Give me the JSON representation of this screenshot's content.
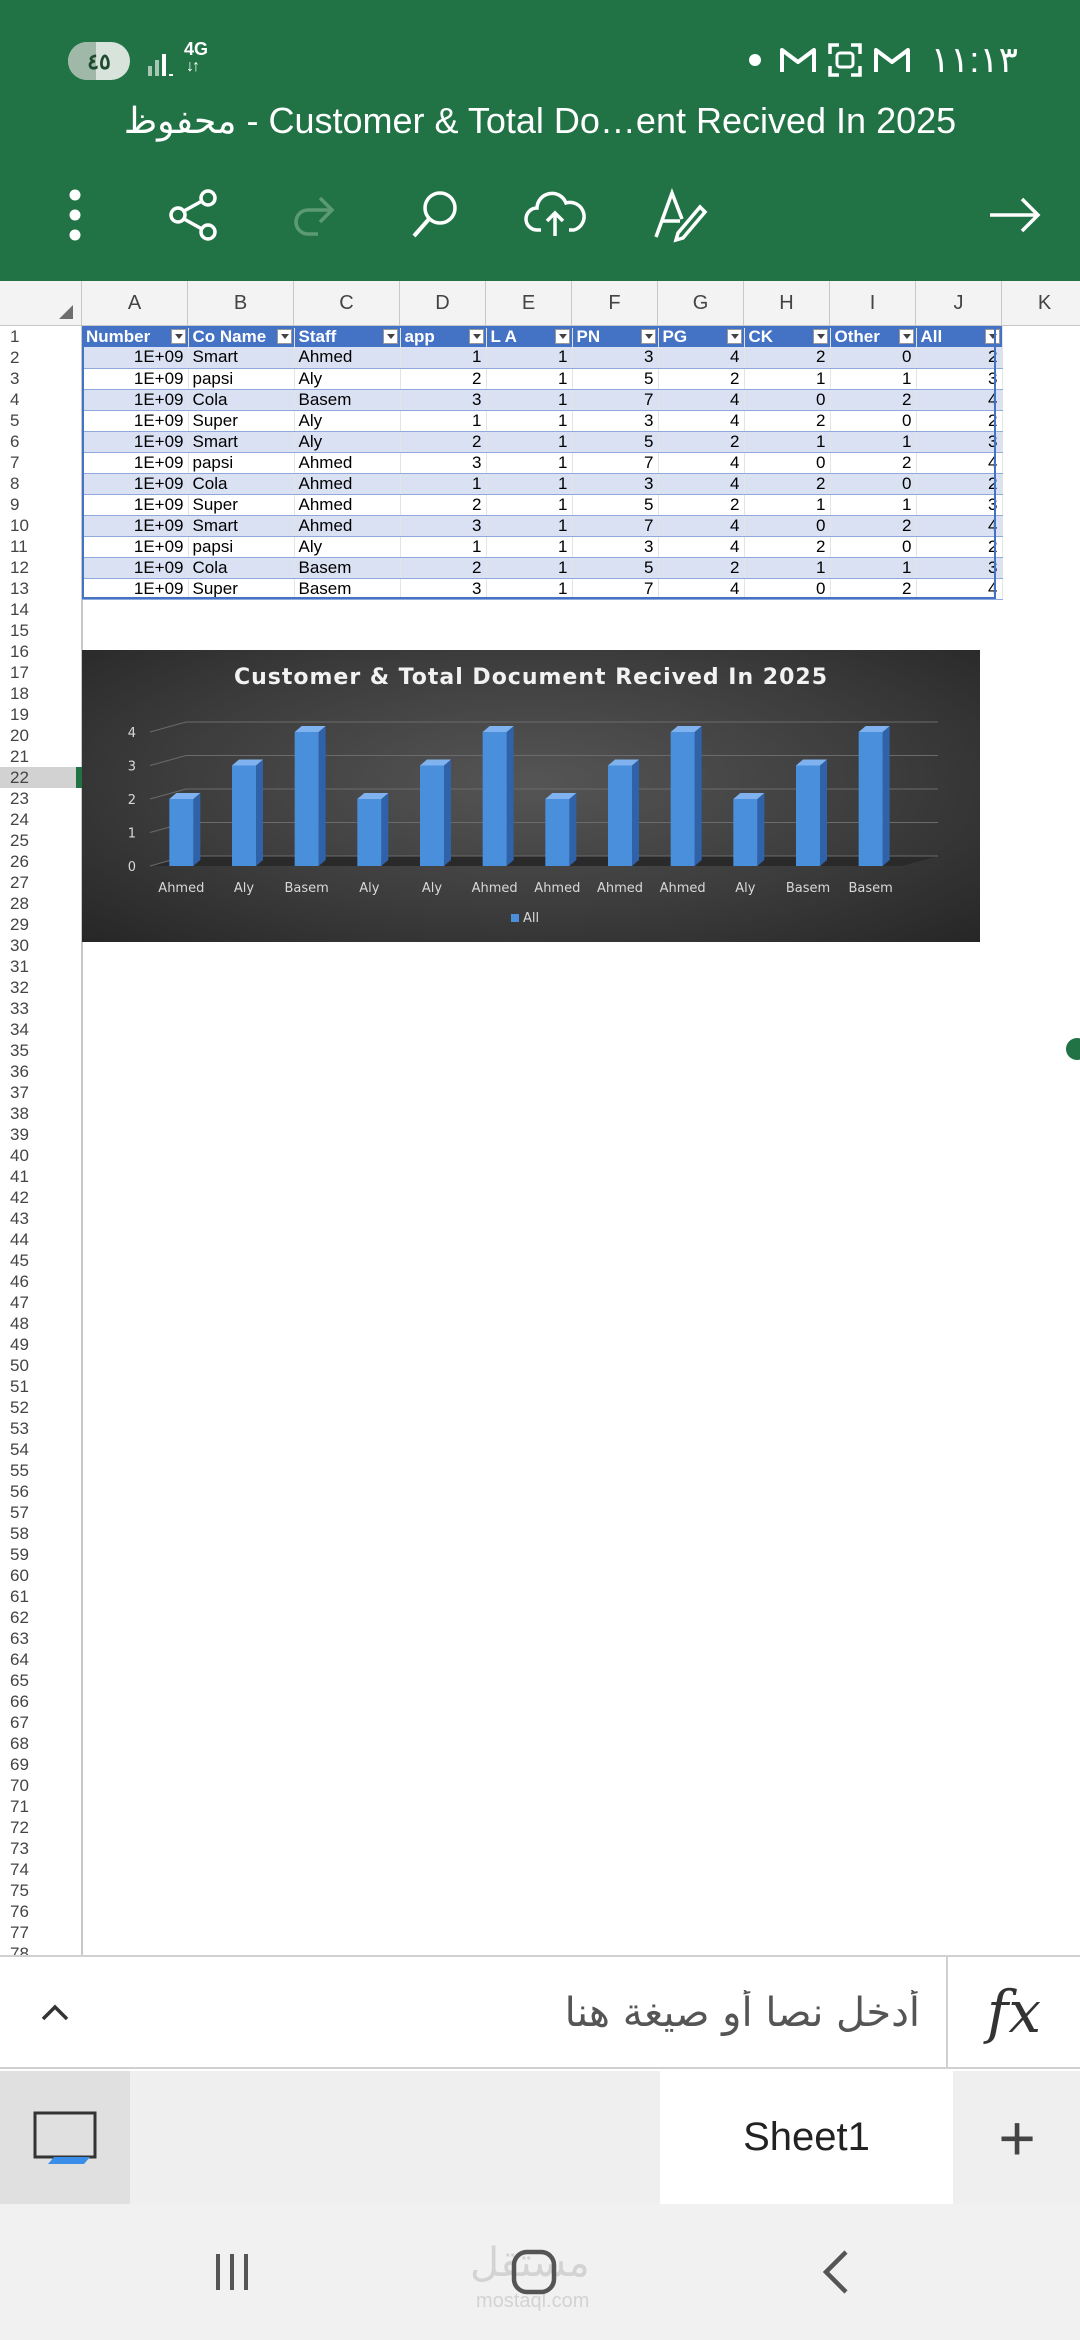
{
  "status_bar": {
    "battery_label": "٤٥",
    "battery_level_percent": 45,
    "network_type": "4G",
    "network_arrows": "↓↑",
    "clock": "١١:١٣",
    "notification_icons": [
      "dot-icon",
      "gmail-icon",
      "scan-icon",
      "gmail-icon"
    ]
  },
  "app_bar": {
    "title": "محفوظ - Customer & Total Do…ent Recived In 2025",
    "icons": [
      "more-vert-icon",
      "share-icon",
      "redo-icon",
      "search-icon",
      "cloud-upload-icon",
      "draw-pen-icon",
      "arrow-forward-icon"
    ],
    "redo_enabled": false
  },
  "grid": {
    "column_headers": [
      "A",
      "B",
      "C",
      "D",
      "E",
      "F",
      "G",
      "H",
      "I",
      "J",
      "K"
    ],
    "row_count_visible": 78,
    "selected_row": 22,
    "table": {
      "headers": [
        "Number",
        "Co Name",
        "Staff",
        "app",
        "L A",
        "PN",
        "PG",
        "CK",
        "Other",
        "All"
      ],
      "rows": [
        [
          "1E+09",
          "Smart",
          "Ahmed",
          "1",
          "1",
          "3",
          "4",
          "2",
          "0",
          "2"
        ],
        [
          "1E+09",
          "papsi",
          "Aly",
          "2",
          "1",
          "5",
          "2",
          "1",
          "1",
          "3"
        ],
        [
          "1E+09",
          "Cola",
          "Basem",
          "3",
          "1",
          "7",
          "4",
          "0",
          "2",
          "4"
        ],
        [
          "1E+09",
          "Super",
          "Aly",
          "1",
          "1",
          "3",
          "4",
          "2",
          "0",
          "2"
        ],
        [
          "1E+09",
          "Smart",
          "Aly",
          "2",
          "1",
          "5",
          "2",
          "1",
          "1",
          "3"
        ],
        [
          "1E+09",
          "papsi",
          "Ahmed",
          "3",
          "1",
          "7",
          "4",
          "0",
          "2",
          "4"
        ],
        [
          "1E+09",
          "Cola",
          "Ahmed",
          "1",
          "1",
          "3",
          "4",
          "2",
          "0",
          "2"
        ],
        [
          "1E+09",
          "Super",
          "Ahmed",
          "2",
          "1",
          "5",
          "2",
          "1",
          "1",
          "3"
        ],
        [
          "1E+09",
          "Smart",
          "Ahmed",
          "3",
          "1",
          "7",
          "4",
          "0",
          "2",
          "4"
        ],
        [
          "1E+09",
          "papsi",
          "Aly",
          "1",
          "1",
          "3",
          "4",
          "2",
          "0",
          "2"
        ],
        [
          "1E+09",
          "Cola",
          "Basem",
          "2",
          "1",
          "5",
          "2",
          "1",
          "1",
          "3"
        ],
        [
          "1E+09",
          "Super",
          "Basem",
          "3",
          "1",
          "7",
          "4",
          "0",
          "2",
          "4"
        ]
      ]
    }
  },
  "chart_data": {
    "type": "bar",
    "title": "Customer & Total Document Recived In 2025",
    "categories": [
      "Ahmed",
      "Aly",
      "Basem",
      "Aly",
      "Aly",
      "Ahmed",
      "Ahmed",
      "Ahmed",
      "Ahmed",
      "Aly",
      "Basem",
      "Basem"
    ],
    "series": [
      {
        "name": "All",
        "values": [
          2,
          3,
          4,
          2,
          3,
          4,
          2,
          3,
          4,
          2,
          3,
          4
        ],
        "color": "#4a8fdc"
      }
    ],
    "ylim": [
      0,
      4
    ],
    "yticks": [
      "0",
      "1",
      "2",
      "3",
      "4"
    ],
    "grid": true,
    "legend": "bottom",
    "background": "#3d3d3d",
    "style": "3d-column"
  },
  "formula_bar": {
    "placeholder": "أدخل نصا أو صيغة هنا",
    "fx_label": "fx"
  },
  "sheet_tabs": {
    "tabs": [
      "Sheet1"
    ],
    "active": "Sheet1",
    "add_label": "+"
  },
  "nav_bar": {
    "watermark": "مستقل",
    "watermark_sub": "mostaql.com"
  },
  "colors": {
    "header_green": "#217346",
    "table_header_blue": "#4472c4",
    "table_band": "#d9e1f2"
  }
}
